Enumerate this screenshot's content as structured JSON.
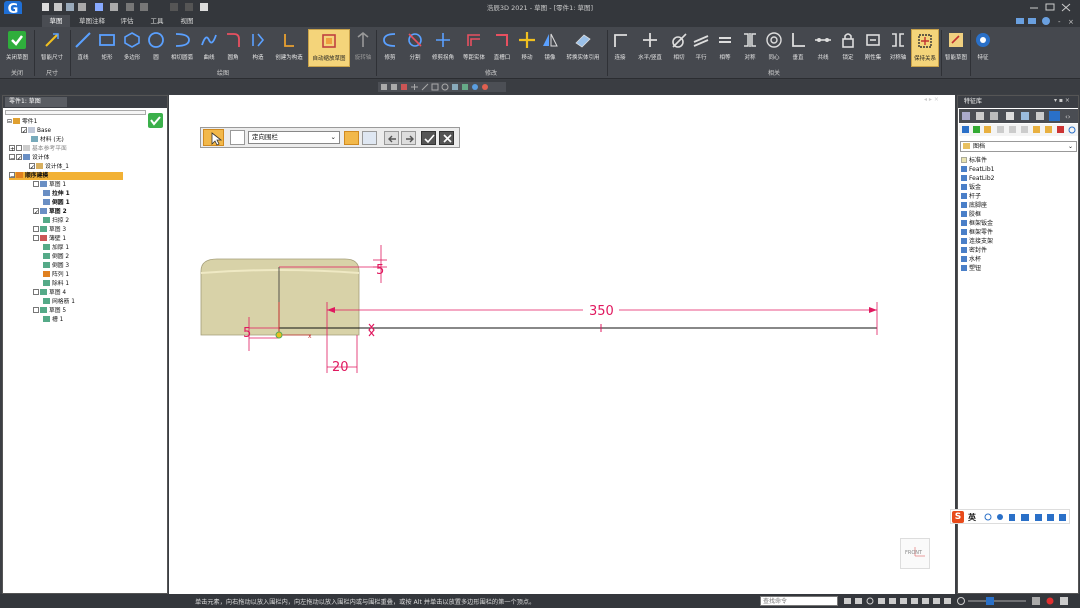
{
  "window": {
    "title": "浩辰3D 2021 - 草图 - [零件1: 草图]"
  },
  "ribbon_tabs": [
    "草图",
    "草图注释",
    "评估",
    "工具",
    "视图"
  ],
  "ribbon": {
    "buttons": [
      {
        "label": "关闭草图"
      },
      {
        "label": "智能尺寸"
      },
      {
        "label": "直线"
      },
      {
        "label": "矩形"
      },
      {
        "label": "多边形"
      },
      {
        "label": "圆"
      },
      {
        "label": "相切圆弧"
      },
      {
        "label": "曲线"
      },
      {
        "label": "圆角"
      },
      {
        "label": "构造"
      },
      {
        "label": "创建为构造"
      },
      {
        "label": "自动缩放草图"
      },
      {
        "label": "旋转轴"
      },
      {
        "label": "修剪"
      },
      {
        "label": "分割"
      },
      {
        "label": "修剪拐角"
      },
      {
        "label": "等距实体"
      },
      {
        "label": "直槽口"
      },
      {
        "label": "移动"
      },
      {
        "label": "镜像"
      },
      {
        "label": "转换实体引用"
      },
      {
        "label": "连接"
      },
      {
        "label": "水平/竖直"
      },
      {
        "label": "相切"
      },
      {
        "label": "平行"
      },
      {
        "label": "相等"
      },
      {
        "label": "对称"
      },
      {
        "label": "同心"
      },
      {
        "label": "垂直"
      },
      {
        "label": "共线"
      },
      {
        "label": "锁定"
      },
      {
        "label": "刚性集"
      },
      {
        "label": "对称轴"
      },
      {
        "label": "保持关系"
      },
      {
        "label": "智能草图"
      },
      {
        "label": "特征"
      }
    ],
    "groups": [
      "关闭",
      "尺寸",
      "绘图",
      "修改",
      "相关"
    ]
  },
  "left_panel": {
    "tab": "零件1: 草图",
    "tree": [
      {
        "label": "零件1"
      },
      {
        "label": "Base"
      },
      {
        "label": "材料 (无)"
      },
      {
        "label": "基本参考平面"
      },
      {
        "label": "设计体"
      },
      {
        "label": "设计体_1"
      },
      {
        "label": "顺序建模"
      },
      {
        "label": "草图 1"
      },
      {
        "label": "拉伸 1"
      },
      {
        "label": "倒圆 1"
      },
      {
        "label": "草图 2"
      },
      {
        "label": "扫掠 2"
      },
      {
        "label": "草图 3"
      },
      {
        "label": "薄壁 1"
      },
      {
        "label": "加厚 1"
      },
      {
        "label": "倒圆 2"
      },
      {
        "label": "倒圆 3"
      },
      {
        "label": "阵列 1"
      },
      {
        "label": "除料 1"
      },
      {
        "label": "草图 4"
      },
      {
        "label": "网格筋 1"
      },
      {
        "label": "草图 5"
      },
      {
        "label": "槽 1"
      }
    ]
  },
  "palette": {
    "select_value": "定向围栏"
  },
  "canvas": {
    "dimensions": {
      "top": "5",
      "left": "5",
      "length": "350",
      "offset": "20"
    },
    "view_label": "FRONT"
  },
  "right_panel": {
    "tab": "特征库",
    "dropdown": "图档",
    "items": [
      "标准件",
      "FeatLib1",
      "FeatLib2",
      "钣金",
      "杆子",
      "底脚座",
      "胶框",
      "框架钣金",
      "框架零件",
      "连接支架",
      "密封件",
      "水杯",
      "塑钮"
    ]
  },
  "ime": {
    "label": "英"
  },
  "statusbar": {
    "message": "单击元素，向右拖动以放入围栏内，向左拖动以放入围栏内或与围栏重叠，或按 Alt 并单击以放置多边形围栏的第一个顶点。",
    "search_placeholder": "查找命令"
  },
  "colors": {
    "dimension": "#e0195f",
    "body": "#d8d2a8",
    "highlight": "#f4d47a"
  }
}
